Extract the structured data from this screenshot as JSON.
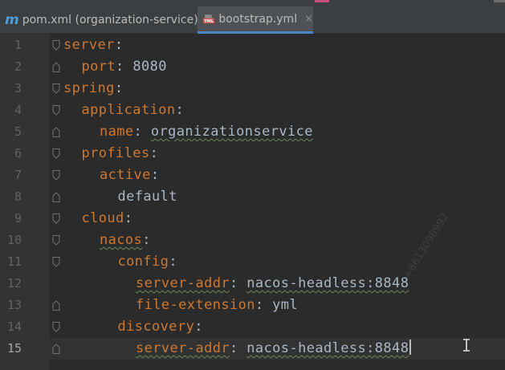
{
  "tabs": [
    {
      "label": "pom.xml (organization-service)",
      "icon": "maven-icon",
      "icon_text": "m",
      "active": false,
      "close": "×"
    },
    {
      "label": "bootstrap.yml",
      "icon": "yml-file-icon",
      "icon_text": "YML",
      "active": true,
      "close": "×"
    }
  ],
  "editor": {
    "current_line": 15,
    "lines": [
      {
        "n": "1",
        "indent": 0,
        "key": "server",
        "value": ""
      },
      {
        "n": "2",
        "indent": 1,
        "key": "port",
        "value": "8080"
      },
      {
        "n": "3",
        "indent": 0,
        "key": "spring",
        "value": ""
      },
      {
        "n": "4",
        "indent": 1,
        "key": "application",
        "value": ""
      },
      {
        "n": "5",
        "indent": 2,
        "key": "name",
        "value": "organizationservice"
      },
      {
        "n": "6",
        "indent": 1,
        "key": "profiles",
        "value": ""
      },
      {
        "n": "7",
        "indent": 2,
        "key": "active",
        "value": ""
      },
      {
        "n": "8",
        "indent": 3,
        "key": "",
        "value": "default"
      },
      {
        "n": "9",
        "indent": 1,
        "key": "cloud",
        "value": ""
      },
      {
        "n": "10",
        "indent": 2,
        "key": "nacos",
        "value": ""
      },
      {
        "n": "11",
        "indent": 3,
        "key": "config",
        "value": ""
      },
      {
        "n": "12",
        "indent": 4,
        "key": "server-addr",
        "value": "nacos-headless:8848"
      },
      {
        "n": "13",
        "indent": 4,
        "key": "file-extension",
        "value": "yml"
      },
      {
        "n": "14",
        "indent": 3,
        "key": "discovery",
        "value": ""
      },
      {
        "n": "15",
        "indent": 4,
        "key": "server-addr",
        "value": "nacos-headless:8848"
      }
    ]
  },
  "watermark": "+8613098992",
  "colors": {
    "background": "#2b2b2b",
    "gutter": "#313335",
    "key": "#cc7832",
    "text": "#a9b7c6",
    "line_number": "#606366",
    "active_tab_underline": "#4a88c7"
  }
}
